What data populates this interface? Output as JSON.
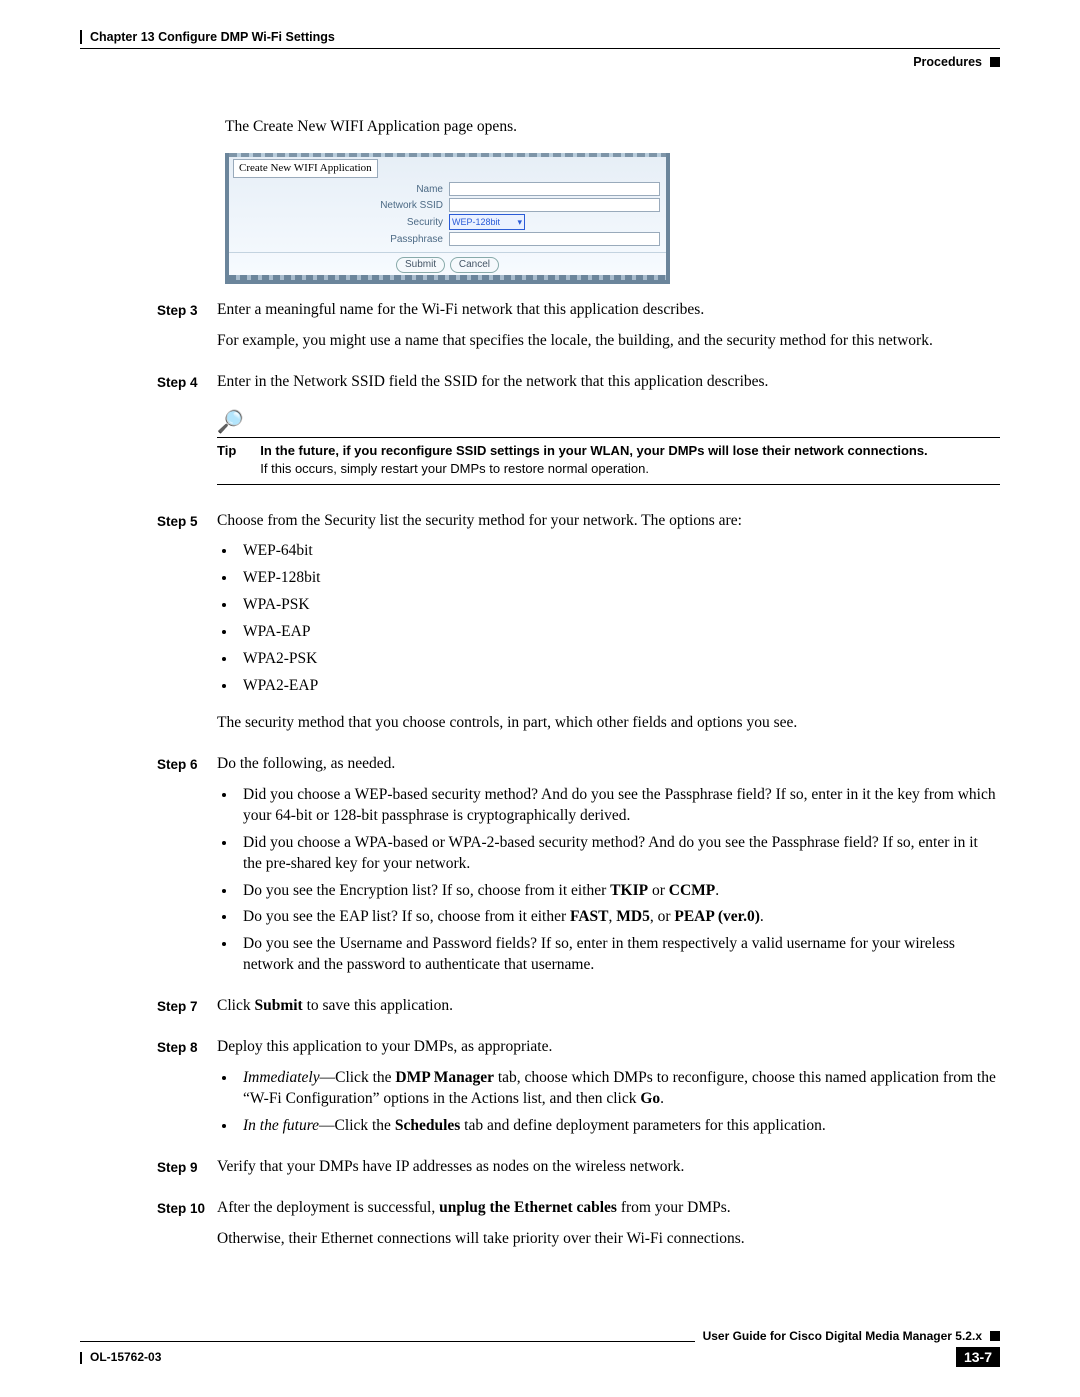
{
  "header": {
    "chapter": "Chapter 13    Configure DMP Wi-Fi Settings",
    "section": "Procedures"
  },
  "intro": "The Create New WIFI Application page opens.",
  "form": {
    "tab": "Create New WIFI Application",
    "labels": {
      "name": "Name",
      "ssid": "Network SSID",
      "security": "Security",
      "passphrase": "Passphrase"
    },
    "security_value": "WEP-128bit",
    "buttons": {
      "submit": "Submit",
      "cancel": "Cancel"
    }
  },
  "steps": {
    "3": {
      "label": "Step 3",
      "p1": "Enter a meaningful name for the Wi-Fi network that this application describes.",
      "p2": "For example, you might use a name that specifies the locale, the building, and the security method for this network."
    },
    "4": {
      "label": "Step 4",
      "p1": "Enter in the Network SSID field the SSID for the network that this application describes."
    },
    "5": {
      "label": "Step 5",
      "p1": "Choose from the Security list the security method for your network. The options are:",
      "opts": [
        "WEP-64bit",
        "WEP-128bit",
        "WPA-PSK",
        "WPA-EAP",
        "WPA2-PSK",
        "WPA2-EAP"
      ],
      "p2": "The security method that you choose controls, in part, which other fields and options you see."
    },
    "6": {
      "label": "Step 6",
      "p1": "Do the following, as needed.",
      "items": {
        "a": "Did you choose a WEP-based security method? And do you see the Passphrase field? If so, enter in it the key from which your 64-bit or 128-bit passphrase is cryptographically derived.",
        "b": "Did you choose a WPA-based or WPA-2-based security method? And do you see the Passphrase field? If so, enter in it the pre-shared key for your network.",
        "c_pre": "Do you see the Encryption list? If so, choose from it either ",
        "c_b1": "TKIP",
        "c_mid": " or ",
        "c_b2": "CCMP",
        "c_post": ".",
        "d_pre": "Do you see the EAP list? If so, choose from it either ",
        "d_b1": "FAST",
        "d_m1": ", ",
        "d_b2": "MD5",
        "d_m2": ", or ",
        "d_b3": "PEAP (ver.0)",
        "d_post": ".",
        "e": "Do you see the Username and Password fields? If so, enter in them respectively a valid username for your wireless network and the password to authenticate that username."
      }
    },
    "7": {
      "label": "Step 7",
      "pre": "Click ",
      "b": "Submit",
      "post": " to save this application."
    },
    "8": {
      "label": "Step 8",
      "p1": "Deploy this application to your DMPs, as appropriate.",
      "a_i": "Immediately",
      "a_dash": "—Click the ",
      "a_b1": "DMP Manager",
      "a_mid": " tab, choose which DMPs to reconfigure, choose this named application from the “W-Fi Configuration” options in the Actions list, and then click ",
      "a_b2": "Go",
      "a_post": ".",
      "b_i": "In the future",
      "b_dash": "—Click the ",
      "b_b1": "Schedules",
      "b_post": " tab and define deployment parameters for this application."
    },
    "9": {
      "label": "Step 9",
      "p1": "Verify that your DMPs have IP addresses as nodes on the wireless network."
    },
    "10": {
      "label": "Step 10",
      "pre": "After the deployment is successful, ",
      "b": "unplug the Ethernet cables",
      "post": " from your DMPs.",
      "p2": "Otherwise, their Ethernet connections will take priority over their Wi-Fi connections."
    }
  },
  "tip": {
    "label": "Tip",
    "bold": "In the future, if you reconfigure SSID settings in your WLAN, your DMPs will lose their network connections.",
    "plain": "If this occurs, simply restart your DMPs to restore normal operation."
  },
  "footer": {
    "guide": "User Guide for Cisco Digital Media Manager 5.2.x",
    "doc": "OL-15762-03",
    "page": "13-7"
  }
}
